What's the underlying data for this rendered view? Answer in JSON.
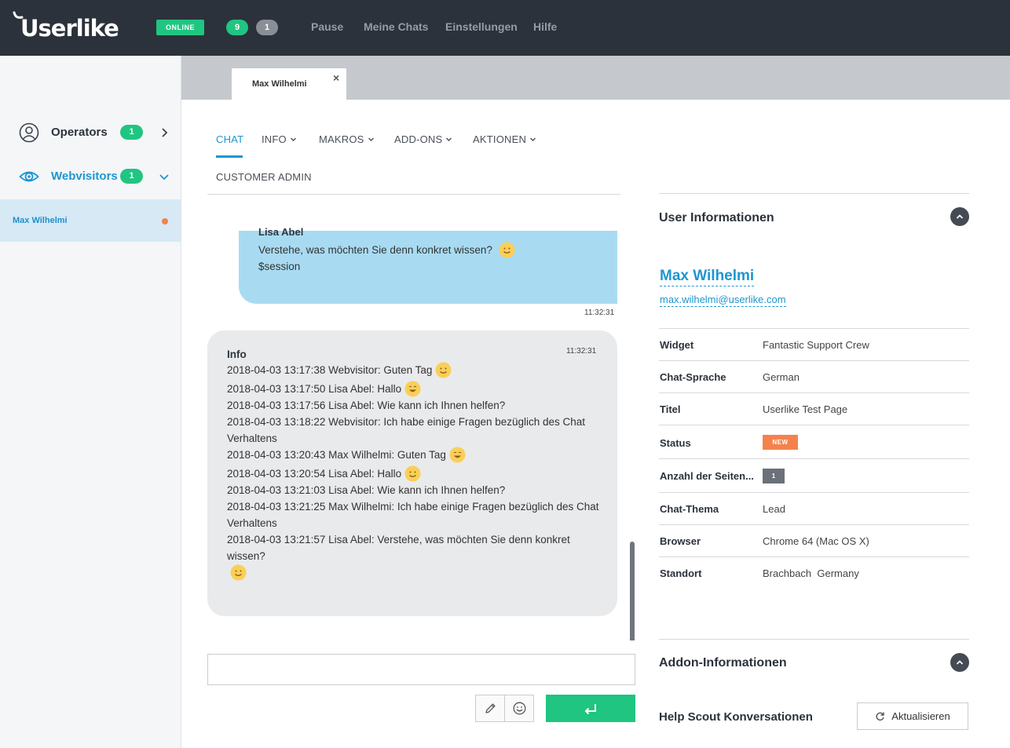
{
  "topbar": {
    "logo": "Userlike",
    "status": "ONLINE",
    "count_green": "9",
    "count_grey": "1",
    "nav": [
      "Pause",
      "Meine Chats",
      "Einstellungen",
      "Hilfe"
    ]
  },
  "sidebar": {
    "operators": {
      "label": "Operators",
      "count": "1"
    },
    "webvisitors": {
      "label": "Webvisitors",
      "count": "1"
    },
    "selected_visitor": "Max Wilhelmi"
  },
  "chat_tab": {
    "name": "Max Wilhelmi",
    "close": "×"
  },
  "chat_nav": {
    "chat": "CHAT",
    "info": "INFO",
    "makros": "MAKROS",
    "addons": "ADD-ONS",
    "aktionen": "AKTIONEN",
    "customer_admin": "CUSTOMER ADMIN"
  },
  "messages": {
    "operator": {
      "author": "Lisa Abel",
      "line1": "Verstehe, was möchten Sie denn konkret wissen?",
      "line2": "$session",
      "time": "11:32:31"
    },
    "info": {
      "title": "Info",
      "time": "11:32:31",
      "lines": [
        "2018-04-03 13:17:38 Webvisitor: Guten Tag",
        "2018-04-03 13:17:50 Lisa Abel: Hallo",
        "2018-04-03 13:17:56 Lisa Abel: Wie kann ich Ihnen helfen?",
        "2018-04-03 13:18:22 Webvisitor: Ich habe einige Fragen bezüglich des Chat Verhaltens",
        "2018-04-03 13:20:43 Max Wilhelmi: Guten Tag",
        "2018-04-03 13:20:54 Lisa Abel: Hallo",
        "2018-04-03 13:21:03 Lisa Abel: Wie kann ich Ihnen helfen?",
        "2018-04-03 13:21:25 Max Wilhelmi: Ich habe einige Fragen bezüglich des Chat Verhaltens",
        "2018-04-03 13:21:57 Lisa Abel: Verstehe, was möchten Sie denn konkret wissen?"
      ]
    }
  },
  "composer": {
    "value": "",
    "placeholder": ""
  },
  "user_info": {
    "heading": "User Informationen",
    "name": "Max Wilhelmi",
    "email": "max.wilhelmi@userlike.com",
    "rows": [
      {
        "key": "Widget",
        "value": "Fantastic Support Crew"
      },
      {
        "key": "Chat-Sprache",
        "value": "German"
      },
      {
        "key": "Titel",
        "value": "Userlike Test Page"
      },
      {
        "key": "Status",
        "value": "NEW"
      },
      {
        "key": "Anzahl der Seiten...",
        "value": "1"
      },
      {
        "key": "Chat-Thema",
        "value": "Lead"
      },
      {
        "key": "Browser",
        "value": "Chrome 64 (Mac OS X)"
      },
      {
        "key": "Standort",
        "value": "Brachbach  Germany"
      }
    ]
  },
  "addon_info": {
    "heading": "Addon-Informationen",
    "subheading": "Help Scout Konversationen",
    "refresh_label": "Aktualisieren"
  },
  "colors": {
    "accent": "#1e96d0",
    "green": "#20c581",
    "topbar": "#2b323b",
    "new_tag": "#f5824c"
  },
  "icons": [
    "user-circle-icon",
    "eye-icon",
    "chevron-right-icon",
    "chevron-down-icon",
    "close-icon",
    "smiley-icon",
    "pencil-icon",
    "emoji-icon",
    "enter-icon",
    "refresh-icon",
    "chevron-up-icon"
  ]
}
